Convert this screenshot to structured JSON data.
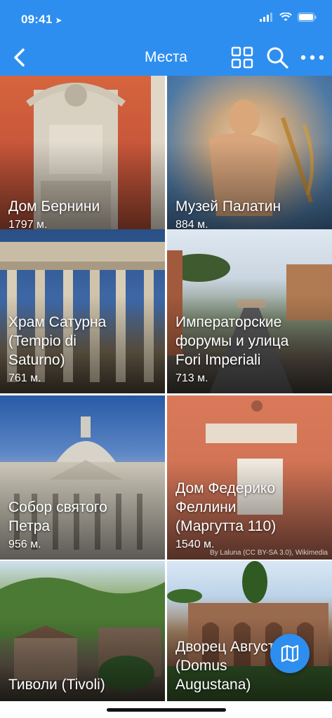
{
  "status_bar": {
    "time": "09:41",
    "location_icon": "location-arrow-icon",
    "icons": [
      "signal-icon",
      "wifi-icon",
      "battery-icon"
    ]
  },
  "nav": {
    "title": "Места",
    "back_icon": "chevron-left-icon",
    "actions": [
      "grid-view-icon",
      "search-icon",
      "more-icon"
    ]
  },
  "places": [
    {
      "name": "Дом Бернини",
      "distance": "1797 м."
    },
    {
      "name": "Музей Палатин",
      "distance": "884 м."
    },
    {
      "name": "Храм Сатурна\n(Tempio di\nSaturno)",
      "distance": "761 м."
    },
    {
      "name": "Императорские\nфорумы и улица\nFori Imperiali",
      "distance": "713 м."
    },
    {
      "name": "Собор святого\nПетра",
      "distance": "956 м."
    },
    {
      "name": "Дом Федерико\nФеллини\n(Маргутта 110)",
      "distance": "1540 м."
    },
    {
      "name": "Тиволи (Tivoli)",
      "distance": ""
    },
    {
      "name": "Дворец Августа\n(Domus\nAugustana)",
      "distance": ""
    }
  ],
  "image_credit": "By Laluna (CC BY-SA 3.0), Wikimedia",
  "fab_icon": "map-icon",
  "colors": {
    "accent": "#2d8ef0"
  }
}
